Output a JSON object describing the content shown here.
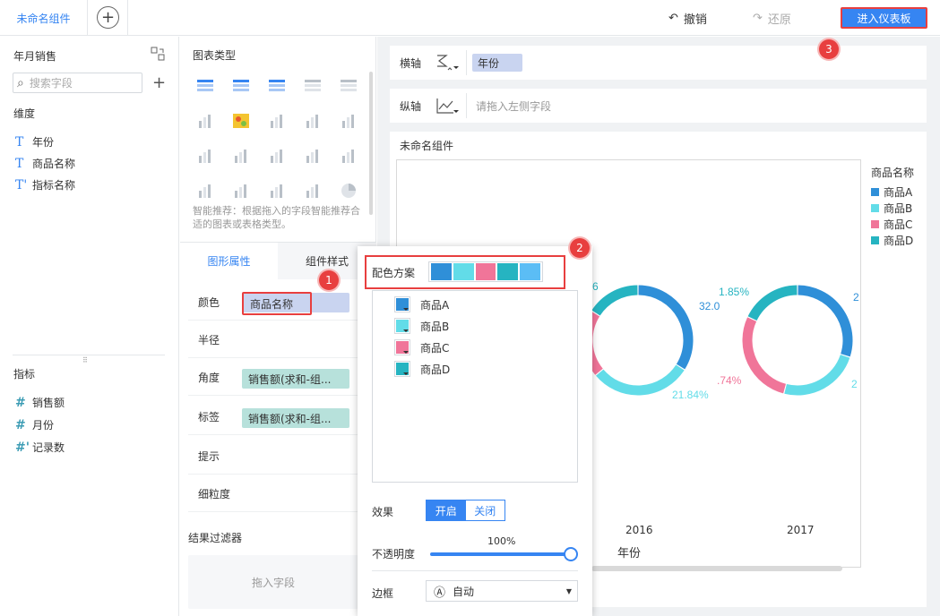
{
  "topbar": {
    "tab_label": "未命名组件",
    "undo_label": "撤销",
    "redo_label": "还原",
    "enter_dashboard_label": "进入仪表板"
  },
  "left": {
    "dataset_title": "年月销售",
    "search_placeholder": "搜索字段",
    "dimension_title": "维度",
    "dimensions": [
      {
        "glyph": "T",
        "label": "年份"
      },
      {
        "glyph": "T",
        "label": "商品名称"
      },
      {
        "glyph": "T'",
        "label": "指标名称"
      }
    ],
    "indicator_title": "指标",
    "indicators": [
      {
        "glyph": "#",
        "label": "销售额"
      },
      {
        "glyph": "#",
        "label": "月份"
      },
      {
        "glyph": "#'",
        "label": "记录数"
      }
    ]
  },
  "middle": {
    "chart_type_title": "图表类型",
    "smart_hint": "智能推荐：根据拖入的字段智能推荐合适的图表或表格类型。",
    "tab_shape": "图形属性",
    "tab_style": "组件样式",
    "props": [
      {
        "label": "颜色",
        "pill": "商品名称"
      },
      {
        "label": "半径",
        "pill": ""
      },
      {
        "label": "角度",
        "pill": "销售额(求和-组..."
      },
      {
        "label": "标签",
        "pill": "销售额(求和-组..."
      },
      {
        "label": "提示",
        "pill": ""
      },
      {
        "label": "细粒度",
        "pill": ""
      }
    ],
    "filter_title": "结果过滤器",
    "filter_placeholder": "拖入字段"
  },
  "axes": {
    "x_label": "横轴",
    "x_field": "年份",
    "y_label": "纵轴",
    "y_placeholder": "请拖入左侧字段"
  },
  "chart": {
    "component_title": "未命名组件",
    "legend_title": "商品名称",
    "axis_name": "年份",
    "categories": [
      "2016",
      "2017"
    ],
    "visible_labels": [
      "6",
      "32.0",
      "21.84%",
      "1.85%",
      "2",
      ".74%",
      "2"
    ]
  },
  "popup": {
    "scheme_label": "配色方案",
    "scheme_colors": [
      "#2f8fd8",
      "#62dce8",
      "#f07599",
      "#26b4c1",
      "#5bbdf5"
    ],
    "items": [
      {
        "label": "商品A",
        "color": "#2f8fd8"
      },
      {
        "label": "商品B",
        "color": "#62dce8"
      },
      {
        "label": "商品C",
        "color": "#f07599"
      },
      {
        "label": "商品D",
        "color": "#26b4c1"
      }
    ],
    "effect_label": "效果",
    "effect_on": "开启",
    "effect_off": "关闭",
    "opacity_label": "不透明度",
    "opacity_value": "100%",
    "border_label": "边框",
    "border_value": "自动",
    "border_glyph": "Ⓐ"
  },
  "badges": [
    "1",
    "2",
    "3"
  ],
  "chart_data": {
    "type": "pie",
    "categories": [
      "2016",
      "2017"
    ],
    "series": [
      {
        "name": "商品A",
        "color": "#2f8fd8"
      },
      {
        "name": "商品B",
        "color": "#62dce8"
      },
      {
        "name": "商品C",
        "color": "#f07599"
      },
      {
        "name": "商品D",
        "color": "#26b4c1"
      }
    ],
    "xlabel": "年份",
    "legend": "right"
  }
}
